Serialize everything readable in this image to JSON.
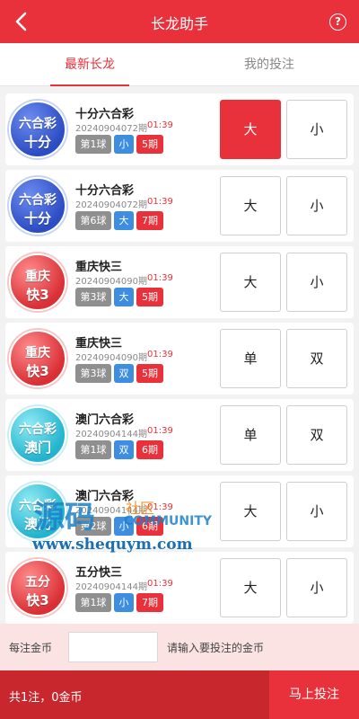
{
  "header": {
    "title": "长龙助手",
    "help_label": "?"
  },
  "tabs": [
    {
      "label": "最新长龙",
      "active": true
    },
    {
      "label": "我的投注",
      "active": false
    }
  ],
  "items": [
    {
      "logo": {
        "line1": "六合彩",
        "line2": "十分",
        "color": "blue"
      },
      "name": "十分六合彩",
      "issue": "20240904072期",
      "time": "01:39",
      "ball": "第1球",
      "value": "小",
      "periods": "5期",
      "option_a": "大",
      "option_b": "小",
      "selected": "a"
    },
    {
      "logo": {
        "line1": "六合彩",
        "line2": "十分",
        "color": "blue"
      },
      "name": "十分六合彩",
      "issue": "20240904072期",
      "time": "01:39",
      "ball": "第6球",
      "value": "大",
      "periods": "7期",
      "option_a": "大",
      "option_b": "小",
      "selected": ""
    },
    {
      "logo": {
        "line1": "重庆",
        "line2": "快3",
        "color": "red"
      },
      "name": "重庆快三",
      "issue": "20240904090期",
      "time": "01:39",
      "ball": "第3球",
      "value": "大",
      "periods": "5期",
      "option_a": "大",
      "option_b": "小",
      "selected": ""
    },
    {
      "logo": {
        "line1": "重庆",
        "line2": "快3",
        "color": "red"
      },
      "name": "重庆快三",
      "issue": "20240904090期",
      "time": "01:39",
      "ball": "第3球",
      "value": "双",
      "periods": "5期",
      "option_a": "单",
      "option_b": "双",
      "selected": ""
    },
    {
      "logo": {
        "line1": "六合彩",
        "line2": "澳门",
        "color": "cyan"
      },
      "name": "澳门六合彩",
      "issue": "20240904144期",
      "time": "01:39",
      "ball": "第1球",
      "value": "双",
      "periods": "6期",
      "option_a": "单",
      "option_b": "双",
      "selected": ""
    },
    {
      "logo": {
        "line1": "六合彩",
        "line2": "澳门",
        "color": "cyan"
      },
      "name": "澳门六合彩",
      "issue": "20240904144期",
      "time": "01:39",
      "ball": "第2球",
      "value": "小",
      "periods": "6期",
      "option_a": "大",
      "option_b": "小",
      "selected": ""
    },
    {
      "logo": {
        "line1": "五分",
        "line2": "快3",
        "color": "red"
      },
      "name": "五分快三",
      "issue": "20240904144期",
      "time": "01:39",
      "ball": "第1球",
      "value": "小",
      "periods": "7期",
      "option_a": "大",
      "option_b": "小",
      "selected": ""
    }
  ],
  "watermark": {
    "big": "源码",
    "small": "社区",
    "community": "COMMUNITY",
    "url": "www.shequym.com"
  },
  "amount": {
    "label": "每注金币",
    "value": "",
    "hint": "请输入要投注的金币"
  },
  "footer": {
    "summary": "共1注，0金币",
    "submit": "马上投注"
  },
  "colors": {
    "primary": "#e8313a",
    "footer": "#c8272e",
    "amount_bg": "#fbe3e3",
    "tag_ball": "#8f8f8f",
    "tag_value": "#3d8de0"
  }
}
